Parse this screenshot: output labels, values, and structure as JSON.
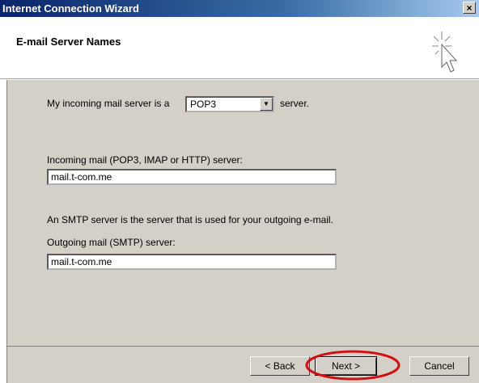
{
  "window": {
    "title": "Internet Connection Wizard",
    "close_glyph": "×"
  },
  "header": {
    "heading": "E-mail Server Names",
    "icon": "wizard-cursor-icon"
  },
  "form": {
    "incoming_type_prefix": "My incoming mail server is a",
    "incoming_type_value": "POP3",
    "incoming_type_suffix": "server.",
    "incoming_label": "Incoming mail (POP3, IMAP or HTTP) server:",
    "incoming_value": "mail.t-com.me",
    "smtp_note": "An SMTP server is the server that is used for your outgoing e-mail.",
    "outgoing_label": "Outgoing mail (SMTP) server:",
    "outgoing_value": "mail.t-com.me"
  },
  "footer": {
    "back_label": "< Back",
    "next_label": "Next >",
    "cancel_label": "Cancel"
  },
  "colors": {
    "dialog_bg": "#d4d0c8",
    "titlebar": "#0a246a",
    "annotation": "#d01010"
  }
}
